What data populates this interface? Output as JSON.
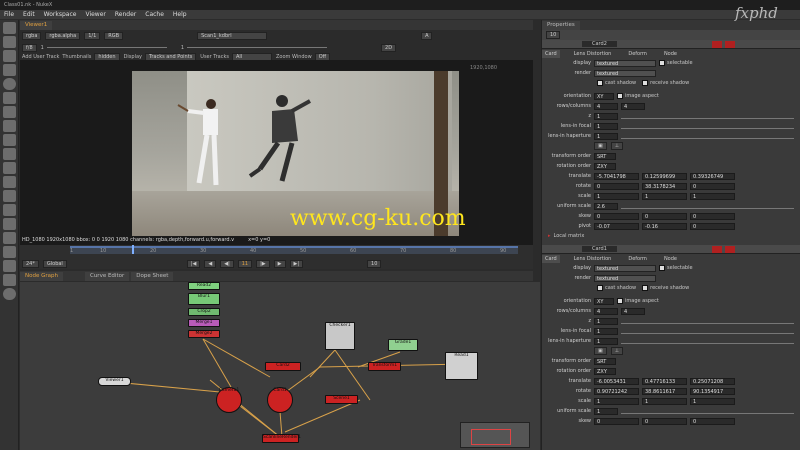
{
  "window": {
    "title": "Class01.nk - NukeX"
  },
  "menu": [
    "File",
    "Edit",
    "Workspace",
    "Viewer",
    "Render",
    "Cache",
    "Help"
  ],
  "viewer": {
    "tab_label": "Viewer1",
    "channels": "rgba",
    "alpha": "rgba.alpha",
    "lut": "RGB",
    "stop": "1/1",
    "zoom_top": "A",
    "input_a": "Scan1_kdbrl",
    "view": "2D",
    "toolbar2_label": "Add User Track",
    "thumbnails_label": "Thumbnails",
    "thumbnails_value": "hidden",
    "display_label": "Display",
    "display_value": "Tracks and Points",
    "usertrack_label": "User Tracks",
    "usertrack_value": "All",
    "zoomwin_label": "Zoom Window",
    "zoomwin_value": "Off",
    "frame_counter": "f/8",
    "info_bar": "HD_1080 1920x1080  bbox: 0 0 1920 1080 channels: rgba,depth,forward.u,forward.v",
    "coords": "x=0 y=0",
    "corner_label": "1920,1080",
    "watermark": "www.cg-ku.com",
    "gain": "1",
    "gamma": "1"
  },
  "timeline": {
    "fps_label": "24*",
    "mode": "Global",
    "current_frame": "11",
    "end_frame": "10",
    "ticks": [
      "1",
      "10",
      "20",
      "30",
      "40",
      "50",
      "60",
      "70",
      "80",
      "90"
    ]
  },
  "node_graph": {
    "tabs": [
      "Node Graph",
      "Curve Editor",
      "Dope Sheet"
    ],
    "nodes": [
      {
        "label": "Read2",
        "color": "#7fd07f"
      },
      {
        "label": "Blur1",
        "color": "#77c977"
      },
      {
        "label": "Crop2",
        "color": "#6fb96f"
      },
      {
        "label": "Merge1",
        "color": "#b85bb8"
      },
      {
        "label": "Merge2",
        "color": "#cc3333"
      },
      {
        "label": "Viewer1",
        "color": "#d8d8d8"
      },
      {
        "label": "Camera1",
        "color": "#cc2222"
      },
      {
        "label": "Card1",
        "color": "#cc2222"
      },
      {
        "label": "Card2",
        "color": "#cc2222"
      },
      {
        "label": "Read1",
        "color": "#d0d0d0"
      },
      {
        "label": "Scene1",
        "color": "#cc2222"
      },
      {
        "label": "ScanlineRender1",
        "color": "#cc2222"
      },
      {
        "label": "Transform1",
        "color": "#cc2222"
      },
      {
        "label": "Checker1",
        "color": "#c8c8c8"
      },
      {
        "label": "Grade1",
        "color": "#90d090"
      }
    ]
  },
  "properties": {
    "title": "Properties",
    "logo": "fxphd",
    "panels": [
      {
        "name": "Card2",
        "tabs": [
          "Card",
          "Lens Distortion",
          "Deform",
          "Node"
        ],
        "display": "textured",
        "render": "textured",
        "selectable": "selectable",
        "cast_shadow": "cast shadow",
        "receive_shadow": "receive shadow",
        "orientation": "XY",
        "image_aspect": "image aspect",
        "rows_columns_label": "rows/columns",
        "rows": "4",
        "cols": "4",
        "z_label": "z",
        "z": "1",
        "lens_focal_label": "lens-in focal",
        "lens_focal": "1",
        "lens_haperture_label": "lens-in haperture",
        "lens_haperture": "1",
        "transform_order_label": "transform order",
        "transform_order": "SRT",
        "rotation_order_label": "rotation order",
        "rotation_order": "ZXY",
        "translate": [
          "-5.7041798",
          "0.12599699",
          "0.39326749"
        ],
        "rotate": [
          "0",
          "38.3178234",
          "0"
        ],
        "scale": [
          "1",
          "1",
          "1"
        ],
        "uniform_scale": "2.6",
        "skew": [
          "0",
          "0",
          "0"
        ],
        "pivot": [
          "-0.07",
          "-0.16",
          "0"
        ],
        "local_matrix": "Local matrix"
      },
      {
        "name": "Card1",
        "tabs": [
          "Card",
          "Lens Distortion",
          "Deform",
          "Node"
        ],
        "display": "textured",
        "render": "textured",
        "selectable": "selectable",
        "cast_shadow": "cast shadow",
        "receive_shadow": "receive shadow",
        "orientation": "XY",
        "image_aspect": "image aspect",
        "rows_columns_label": "rows/columns",
        "rows": "4",
        "cols": "4",
        "z_label": "z",
        "z": "1",
        "lens_focal_label": "lens-in focal",
        "lens_focal": "1",
        "lens_haperture_label": "lens-in haperture",
        "lens_haperture": "1",
        "transform_order_label": "transform order",
        "transform_order": "SRT",
        "rotation_order_label": "rotation order",
        "rotation_order": "ZXY",
        "translate": [
          "-6.0053431",
          "0.47716133",
          "0.25071208"
        ],
        "rotate": [
          "0.90721242",
          "38.8611617",
          "90.1354917"
        ],
        "scale": [
          "1",
          "1",
          "1"
        ],
        "uniform_scale": "1",
        "skew": [
          "0",
          "0",
          "0"
        ]
      }
    ],
    "labels": {
      "display": "display",
      "render": "render",
      "orientation": "orientation",
      "translate": "translate",
      "rotate": "rotate",
      "scale": "scale",
      "uniform_scale": "uniform scale",
      "skew": "skew",
      "pivot": "pivot"
    }
  }
}
